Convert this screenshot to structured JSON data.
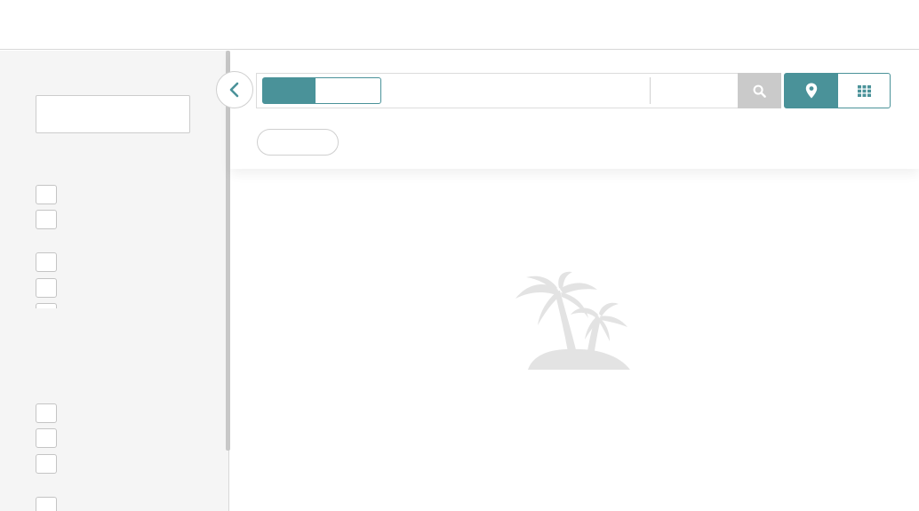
{
  "topbar": {
    "title": ""
  },
  "sidebar": {
    "filter": {
      "value": "",
      "placeholder": ""
    },
    "groups": [
      {
        "items": [
          {
            "label": "",
            "checked": false
          },
          {
            "label": "",
            "checked": false
          }
        ]
      },
      {
        "items": [
          {
            "label": "",
            "checked": false
          },
          {
            "label": "",
            "checked": false
          },
          {
            "label": "",
            "checked": false
          }
        ]
      },
      {
        "items": [
          {
            "label": "",
            "checked": false
          },
          {
            "label": "",
            "checked": false
          },
          {
            "label": "",
            "checked": false
          },
          {
            "label": "",
            "checked": false
          }
        ]
      }
    ]
  },
  "search": {
    "mode_toggle": {
      "left_label": "",
      "right_label": "",
      "selected": "left"
    },
    "query": {
      "value": "",
      "placeholder": ""
    },
    "secondary": {
      "value": "",
      "placeholder": ""
    },
    "search_button_icon": "search-icon"
  },
  "view_toggle": {
    "selected": "map",
    "options": [
      "map-marker-icon",
      "grid-icon"
    ]
  },
  "chip": {
    "label": ""
  },
  "empty_state": {
    "icon": "palm-island-icon",
    "message": ""
  },
  "colors": {
    "accent": "#4a9299",
    "search_button": "#cacaca",
    "sidebar_bg": "#f5f5f5",
    "illustration": "#e3e3e3"
  }
}
